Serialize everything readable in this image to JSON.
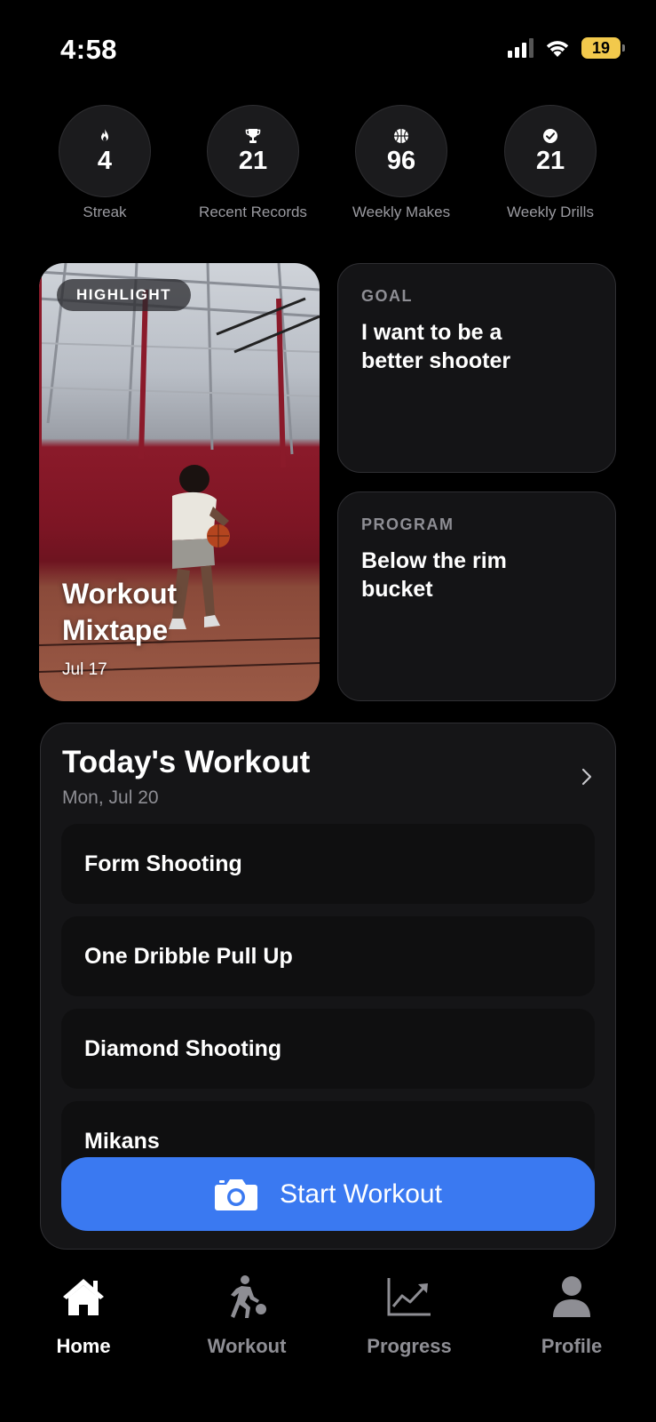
{
  "status_bar": {
    "time": "4:58",
    "battery": "19",
    "battery_level": 0.19
  },
  "stats": [
    {
      "icon": "flame-icon",
      "value": "4",
      "label": "Streak"
    },
    {
      "icon": "trophy-icon",
      "value": "21",
      "label": "Recent Records"
    },
    {
      "icon": "basketball-icon",
      "value": "96",
      "label": "Weekly Makes"
    },
    {
      "icon": "checkmark-circle-icon",
      "value": "21",
      "label": "Weekly Drills"
    }
  ],
  "highlight": {
    "badge": "HIGHLIGHT",
    "title": "Workout Mixtape",
    "date": "Jul 17"
  },
  "goal": {
    "label": "GOAL",
    "text": "I want to be a better shooter"
  },
  "program": {
    "label": "PROGRAM",
    "text": "Below the rim bucket"
  },
  "todays_workout": {
    "title": "Today's Workout",
    "date": "Mon, Jul 20",
    "drills": [
      "Form Shooting",
      "One Dribble Pull Up",
      "Diamond Shooting",
      "Mikans"
    ]
  },
  "start_button": {
    "label": "Start Workout",
    "icon": "camera-icon"
  },
  "tabs": [
    {
      "label": "Home",
      "icon": "house-icon",
      "active": true
    },
    {
      "label": "Workout",
      "icon": "player-dribbling-icon",
      "active": false
    },
    {
      "label": "Progress",
      "icon": "trend-chart-icon",
      "active": false
    },
    {
      "label": "Profile",
      "icon": "person-icon",
      "active": false
    }
  ],
  "colors": {
    "accent": "#3a79f1",
    "battery": "#f2c94c",
    "card": "#151517",
    "muted": "#8e8e94"
  }
}
